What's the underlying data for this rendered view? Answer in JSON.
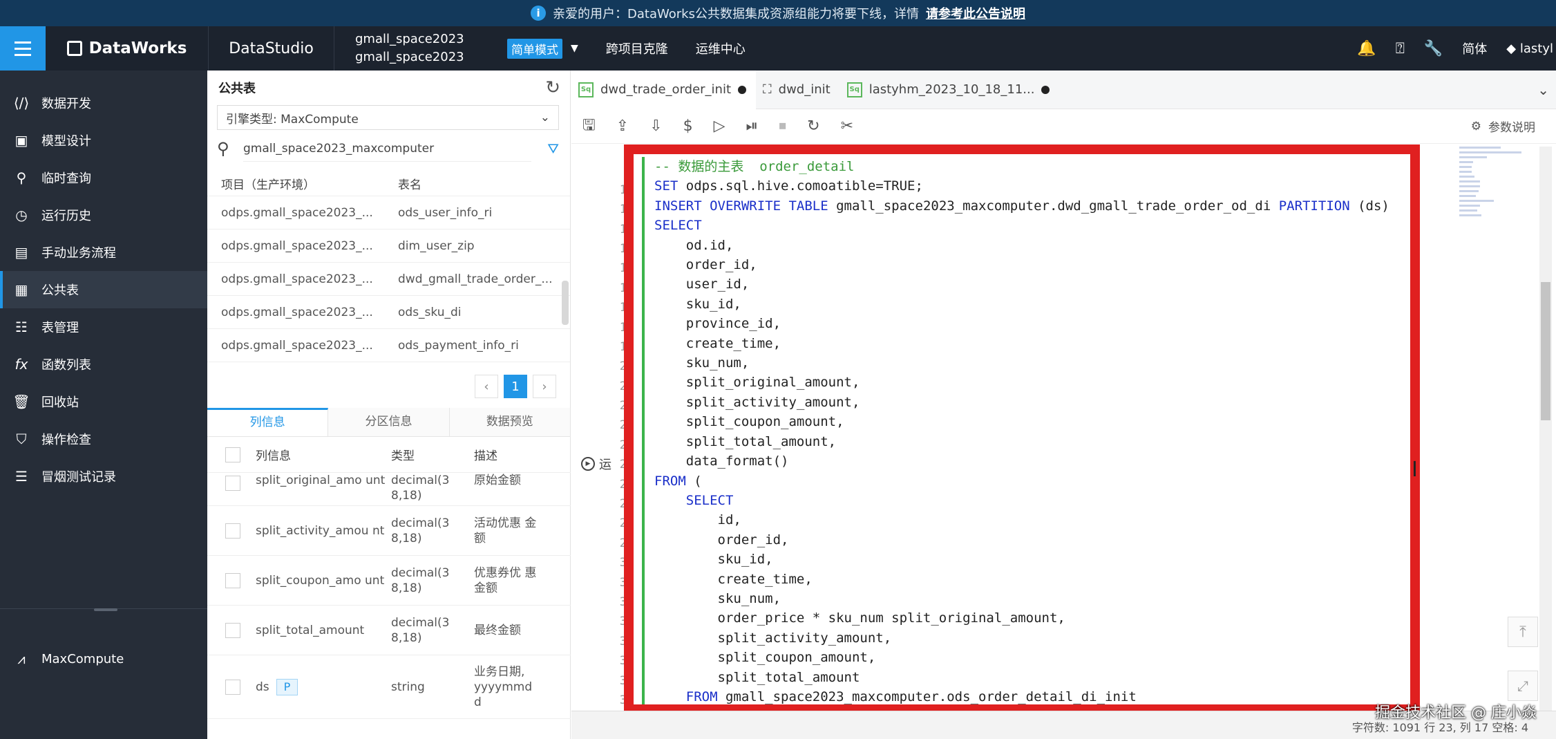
{
  "notice": {
    "text": "亲爱的用户：DataWorks公共数据集成资源组能力将要下线，详情",
    "link": "请参考此公告说明"
  },
  "topnav": {
    "brand": "DataWorks",
    "studio": "DataStudio",
    "workspace_line1": "gmall_space2023",
    "workspace_line2": "gmall_space2023",
    "mode": "简单模式",
    "links": [
      "跨项目克隆",
      "运维中心"
    ],
    "lang": "简体",
    "user": "lastyl"
  },
  "sidebar": {
    "items": [
      {
        "label": "数据开发",
        "icon": "code-icon"
      },
      {
        "label": "模型设计",
        "icon": "cube-icon"
      },
      {
        "label": "临时查询",
        "icon": "search-icon"
      },
      {
        "label": "运行历史",
        "icon": "clock-icon"
      },
      {
        "label": "手动业务流程",
        "icon": "briefcase-icon"
      },
      {
        "label": "公共表",
        "icon": "table-icon"
      },
      {
        "label": "表管理",
        "icon": "table-manage-icon"
      },
      {
        "label": "函数列表",
        "icon": "function-icon"
      },
      {
        "label": "回收站",
        "icon": "trash-icon"
      },
      {
        "label": "操作检查",
        "icon": "shield-check-icon"
      },
      {
        "label": "冒烟测试记录",
        "icon": "list-icon"
      }
    ],
    "bottom": "MaxCompute"
  },
  "panel": {
    "title": "公共表",
    "engine": "引擎类型:  MaxCompute",
    "search_value": "gmall_space2023_maxcomputer",
    "col_project": "项目（生产环境）",
    "col_table": "表名",
    "rows": [
      {
        "project": "odps.gmall_space2023_...",
        "table": "ods_user_info_ri"
      },
      {
        "project": "odps.gmall_space2023_...",
        "table": "dim_user_zip"
      },
      {
        "project": "odps.gmall_space2023_...",
        "table": "dwd_gmall_trade_order_..."
      },
      {
        "project": "odps.gmall_space2023_...",
        "table": "ods_sku_di"
      },
      {
        "project": "odps.gmall_space2023_...",
        "table": "ods_payment_info_ri"
      }
    ],
    "page": "1",
    "tabs": [
      "列信息",
      "分区信息",
      "数据预览"
    ],
    "col_headers": [
      "列信息",
      "类型",
      "描述"
    ],
    "cols": [
      {
        "name": "split_original_amo unt",
        "type": "decimal(3 8,18)",
        "desc": "原始金额"
      },
      {
        "name": "split_activity_amou nt",
        "type": "decimal(3 8,18)",
        "desc": "活动优惠 金额"
      },
      {
        "name": "split_coupon_amo unt",
        "type": "decimal(3 8,18)",
        "desc": "优惠券优 惠金额"
      },
      {
        "name": "split_total_amount",
        "type": "decimal(3 8,18)",
        "desc": "最终金额"
      },
      {
        "name": "ds",
        "tag": "P",
        "type": "string",
        "desc": "业务日期, yyyymmd d"
      }
    ]
  },
  "editor": {
    "tabs": [
      {
        "label": "dwd_trade_order_init"
      },
      {
        "label": "dwd_init"
      },
      {
        "label": "lastyhm_2023_10_18_11..."
      }
    ],
    "param_label": "参数说明",
    "run_label": "运",
    "gutter": [
      "",
      "",
      "1",
      "1",
      "1",
      "1",
      "1",
      "1",
      "1",
      "1",
      "1",
      "2",
      "2",
      "2",
      "2",
      "2",
      "2",
      "2",
      "2",
      "2",
      "2",
      "3",
      "3",
      "3",
      "3",
      "3",
      "3",
      "3",
      "3"
    ],
    "code": {
      "l1_comment": "-- 数据的主表  order_detail",
      "l2_kw": "SET",
      "l2_rest": " odps.sql.hive.comoatible=TRUE;",
      "l3_kw": "INSERT OVERWRITE TABLE",
      "l3_mid": " gmall_space2023_maxcomputer.dwd_gmall_trade_order_od_di ",
      "l3_kw2": "PARTITION",
      "l3_end": " (ds)",
      "l4_kw": "SELECT",
      "l5": "    od.id,",
      "l6": "    order_id,",
      "l7": "    user_id,",
      "l8": "    sku_id,",
      "l9": "    province_id,",
      "l10": "    create_time,",
      "l11": "    sku_num,",
      "l12": "    split_original_amount,",
      "l13": "    split_activity_amount,",
      "l14": "    split_coupon_amount,",
      "l15": "    split_total_amount,",
      "l16": "    data_format()",
      "l17_kw": "FROM",
      "l17_rest": " (",
      "l18_kw": "    SELECT",
      "l19": "        id,",
      "l20": "        order_id,",
      "l21": "        sku_id,",
      "l22": "        create_time,",
      "l23": "        sku_num,",
      "l24": "        order_price * sku_num split_original_amount,",
      "l25": "        split_activity_amount,",
      "l26": "        split_coupon_amount,",
      "l27": "        split_total_amount",
      "l28_kw": "    FROM",
      "l28_rest": " gmall_space2023_maxcomputer.ods_order_detail_di_init"
    },
    "status": "字符数: 1091   行 23, 列 17   空格: 4"
  },
  "watermark": "掘金技术社区 @ 庄小焱",
  "colors": {
    "accent": "#2196e6",
    "highlight_box": "#e02020",
    "sidebar_bg": "#262d38"
  }
}
